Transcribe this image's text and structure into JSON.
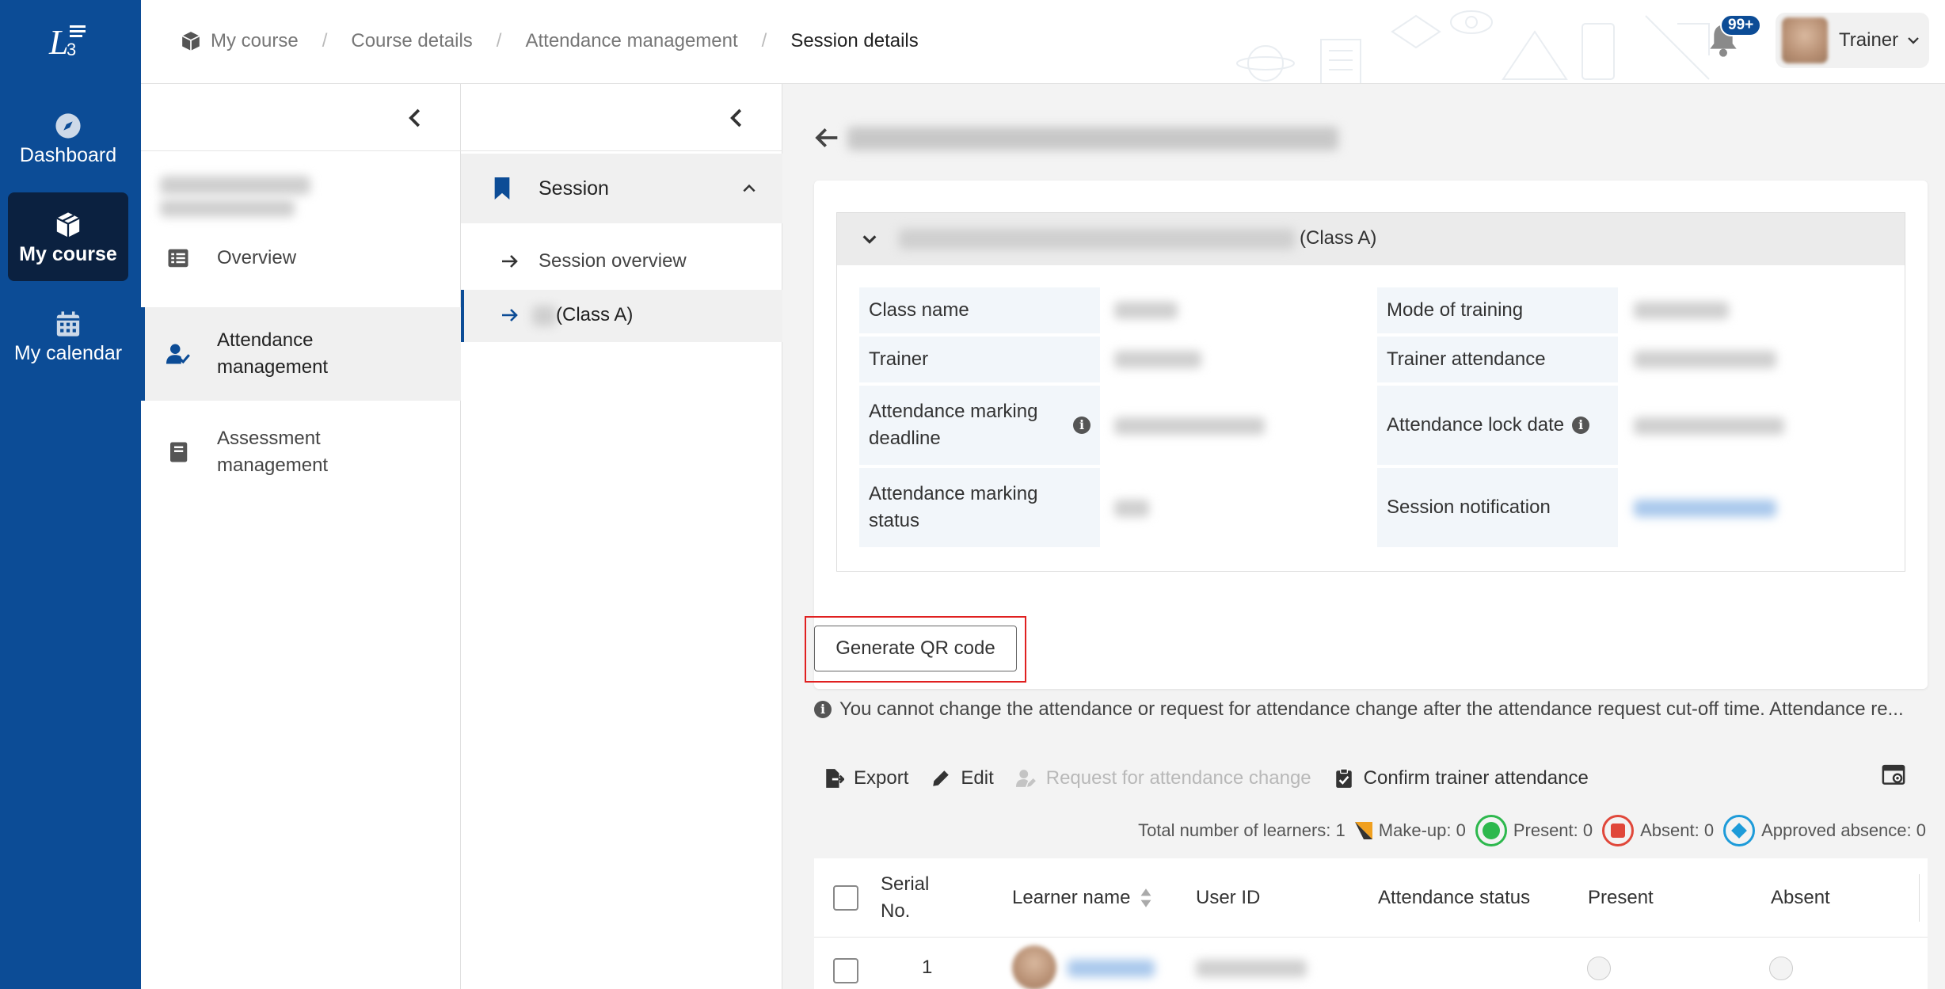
{
  "rail": {
    "items": [
      {
        "label": "Dashboard",
        "icon": "compass-icon"
      },
      {
        "label": "My course",
        "icon": "box-icon"
      },
      {
        "label": "My calendar",
        "icon": "calendar-icon"
      }
    ]
  },
  "header": {
    "breadcrumbs": [
      "My course",
      "Course details",
      "Attendance management",
      "Session details"
    ],
    "notification_count": "99+",
    "user_role": "Trainer"
  },
  "left_nav": {
    "items": [
      {
        "label": "Overview"
      },
      {
        "label_line1": "Attendance",
        "label_line2": "management"
      },
      {
        "label_line1": "Assessment",
        "label_line2": "management"
      }
    ]
  },
  "session_panel": {
    "section_label": "Session",
    "items": [
      "Session overview",
      "(Class A)"
    ]
  },
  "details": {
    "class_suffix": "(Class A)",
    "labels": {
      "class_name": "Class name",
      "mode_of_training": "Mode of training",
      "trainer": "Trainer",
      "trainer_attendance": "Trainer attendance",
      "marking_deadline_line1": "Attendance marking",
      "marking_deadline_line2": "deadline",
      "lock_date": "Attendance lock date",
      "marking_status_line1": "Attendance marking",
      "marking_status_line2": "status",
      "session_notification": "Session notification"
    }
  },
  "actions": {
    "generate_qr": "Generate QR code",
    "notice": "You cannot change the attendance or request for attendance change after the attendance request cut-off time. Attendance re..."
  },
  "toolbar": {
    "export": "Export",
    "edit": "Edit",
    "request_change": "Request for attendance change",
    "confirm_trainer": "Confirm trainer attendance"
  },
  "legend": {
    "total": "Total number of learners: 1",
    "makeup": "Make-up: 0",
    "present": "Present: 0",
    "absent": "Absent: 0",
    "approved": "Approved absence: 0"
  },
  "table": {
    "headers": {
      "serial_line1": "Serial",
      "serial_line2": "No.",
      "learner_name": "Learner name",
      "user_id": "User ID",
      "attendance_status": "Attendance status",
      "present": "Present",
      "absent": "Absent"
    },
    "rows": [
      {
        "serial": "1"
      }
    ]
  },
  "colors": {
    "brand": "#0c4c96",
    "rail_active": "#0b2140",
    "makeup": "#f0a020",
    "present": "#2db84d",
    "absent": "#e0473a",
    "approved": "#1d9bd9",
    "highlight_frame": "#e02020"
  }
}
